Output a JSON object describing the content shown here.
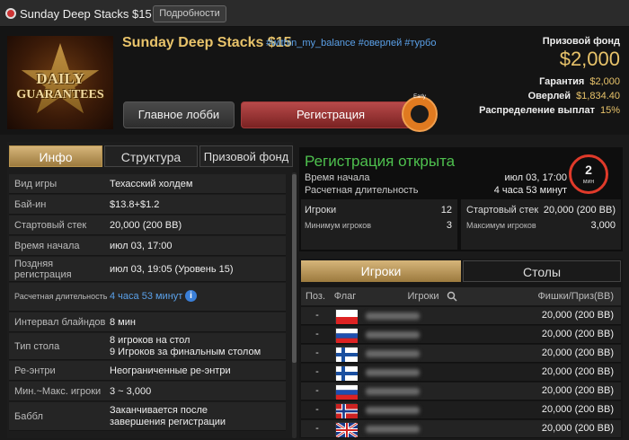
{
  "window": {
    "title": "Sunday Deep Stacks $15",
    "details_button": "Подробности"
  },
  "banner": {
    "line1": "DAILY",
    "line2": "GUARANTEES",
    "badge_text": "Early"
  },
  "tournament": {
    "name": "Sunday Deep Stacks $15",
    "tags": "#within_my_balance #оверлей #турбо"
  },
  "actions": {
    "lobby": "Главное лобби",
    "register": "Регистрация"
  },
  "prize": {
    "label": "Призовой фонд",
    "value": "$2,000",
    "stats": [
      {
        "k": "Гарантия",
        "v": "$2,000"
      },
      {
        "k": "Оверлей",
        "v": "$1,834.40"
      },
      {
        "k": "Распределение выплат",
        "v": "15%"
      }
    ]
  },
  "info_tabs": [
    "Инфо",
    "Структура",
    "Призовой фонд"
  ],
  "info_rows": [
    {
      "k": "Вид игры",
      "v": "Техасский холдем"
    },
    {
      "k": "Бай-ин",
      "v": "$13.8+$1.2"
    },
    {
      "k": "Стартовый стек",
      "v": "20,000 (200 BB)"
    },
    {
      "k": "Время начала",
      "v": "июл 03, 17:00"
    },
    {
      "k": "Поздняя регистрация",
      "v": "июл 03, 19:05 (Уровень 15)"
    },
    {
      "k": "Расчетная длительность",
      "v": "4 часа 53 минут"
    },
    {
      "k": "Интервал блайндов",
      "v": "8 мин"
    },
    {
      "k": "Тип стола",
      "v": "8 игроков на стол",
      "v2": "9 Игроков за финальным столом"
    },
    {
      "k": "Ре-энтри",
      "v": "Неограниченные ре-энтри"
    },
    {
      "k": "Мин.~Макс. игроки",
      "v": "3 ~ 3,000"
    },
    {
      "k": "Баббл",
      "v": "Заканчивается после",
      "v2": "завершения регистрации"
    }
  ],
  "registration": {
    "status": "Регистрация открыта",
    "start_label": "Время начала",
    "start_value": "июл 03, 17:00",
    "duration_label": "Расчетная длительность",
    "duration_value": "4 часа 53 минут",
    "timer_value": "2",
    "timer_unit": "мин",
    "players_label": "Игроки",
    "players_value": "12",
    "min_label": "Минимум игроков",
    "min_value": "3",
    "stack_label": "Стартовый стек",
    "stack_value": "20,000 (200 BB)",
    "max_label": "Максимум игроков",
    "max_value": "3,000"
  },
  "player_tabs": [
    "Игроки",
    "Столы"
  ],
  "player_columns": [
    "Поз.",
    "Флаг",
    "Игроки",
    "Фишки/Приз(BB)"
  ],
  "players": [
    {
      "pos": "-",
      "flag": "poland",
      "chips": "20,000 (200 BB)"
    },
    {
      "pos": "-",
      "flag": "russia",
      "chips": "20,000 (200 BB)"
    },
    {
      "pos": "-",
      "flag": "finland",
      "chips": "20,000 (200 BB)"
    },
    {
      "pos": "-",
      "flag": "finland",
      "chips": "20,000 (200 BB)"
    },
    {
      "pos": "-",
      "flag": "russia",
      "chips": "20,000 (200 BB)"
    },
    {
      "pos": "-",
      "flag": "norway",
      "chips": "20,000 (200 BB)"
    },
    {
      "pos": "-",
      "flag": "uk",
      "chips": "20,000 (200 BB)"
    }
  ]
}
